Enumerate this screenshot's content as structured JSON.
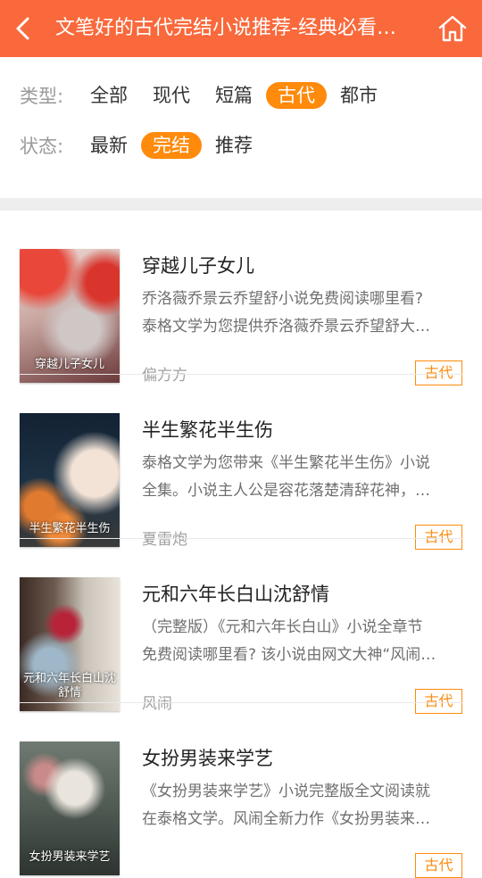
{
  "header": {
    "title": "文笔好的古代完结小说推荐-经典必看…",
    "bg_color": "#f9693b"
  },
  "filters": {
    "type_label": "类型:",
    "type_options": [
      "全部",
      "现代",
      "短篇",
      "古代",
      "都市"
    ],
    "type_selected": "古代",
    "status_label": "状态:",
    "status_options": [
      "最新",
      "完结",
      "推荐"
    ],
    "status_selected": "完结",
    "accent_color": "#ff8a0b"
  },
  "books": [
    {
      "title": "穿越儿子女儿",
      "cover_text": "穿越儿子女儿",
      "desc_line1": "乔洛薇乔景云乔望舒小说免费阅读哪里看?",
      "desc_line2": "泰格文学为您提供乔洛薇乔景云乔望舒大…",
      "author": "偏方方",
      "tag": "古代"
    },
    {
      "title": "半生繁花半生伤",
      "cover_text": "半生繁花半生伤",
      "desc_line1": "泰格文学为您带来《半生繁花半生伤》小说",
      "desc_line2": "全集。小说主人公是容花落楚清辞花神，…",
      "author": "夏雷炮",
      "tag": "古代"
    },
    {
      "title": "元和六年长白山沈舒情",
      "cover_text": "元和六年长白山沈舒情",
      "desc_line1": "（完整版）《元和六年长白山》小说全章节",
      "desc_line2": "免费阅读哪里看? 该小说由网文大神“风闹…",
      "author": "风闹",
      "tag": "古代"
    },
    {
      "title": "女扮男装来学艺",
      "cover_text": "女扮男装来学艺",
      "desc_line1": "《女扮男装来学艺》小说完整版全文阅读就",
      "desc_line2": "在泰格文学。风闹全新力作《女扮男装来…",
      "author": "",
      "tag": "古代"
    }
  ]
}
